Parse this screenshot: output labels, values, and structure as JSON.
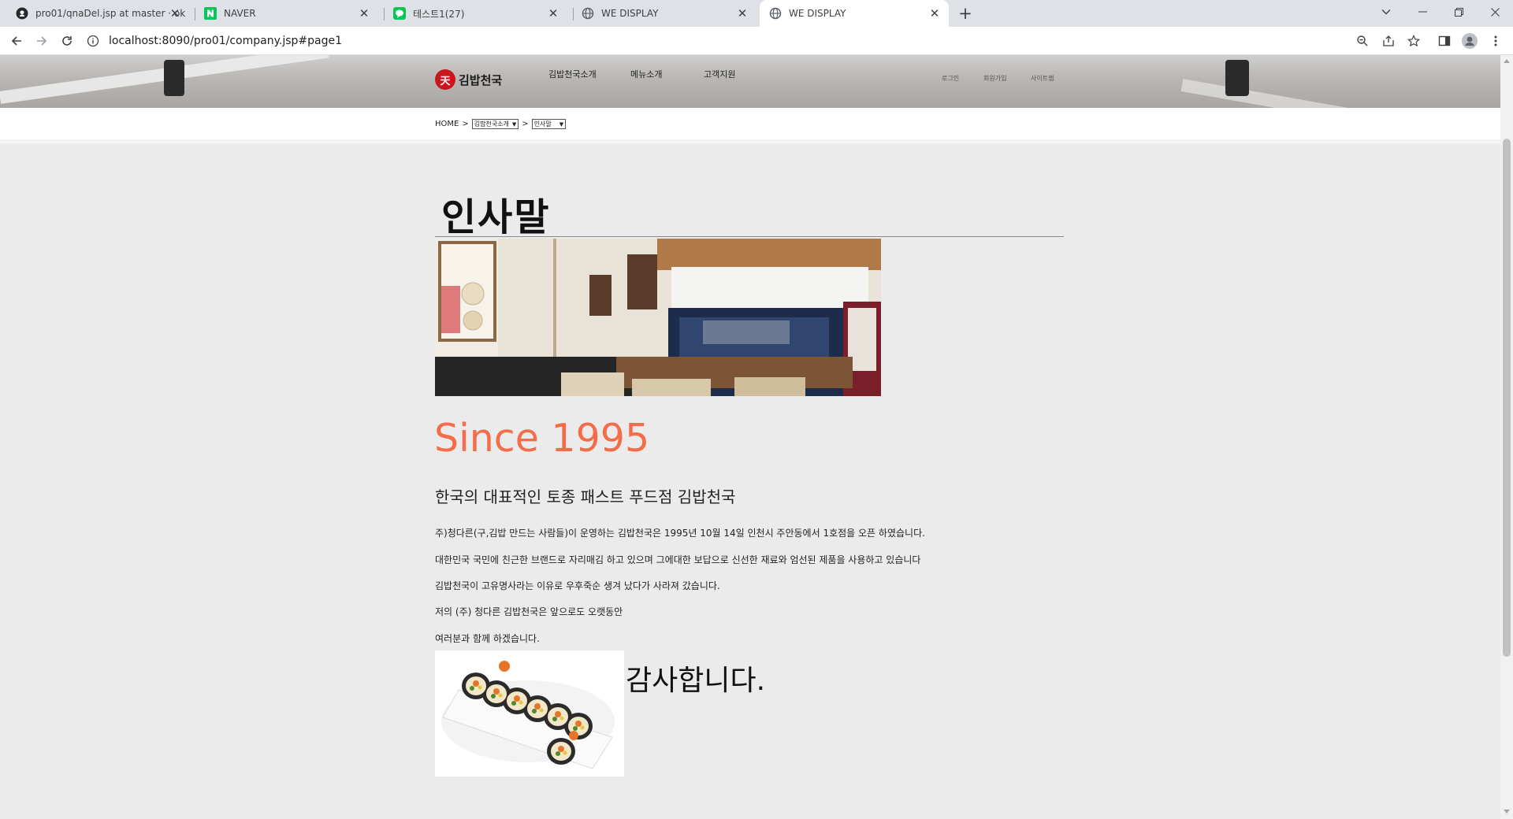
{
  "browser": {
    "tabs": [
      {
        "title": "pro01/qnaDel.jsp at master · ok",
        "icon": "github-icon",
        "active": false
      },
      {
        "title": "NAVER",
        "icon": "naver-icon",
        "active": false
      },
      {
        "title": "테스트1(27)",
        "icon": "chat-icon",
        "active": false
      },
      {
        "title": "WE DISPLAY",
        "icon": "globe-icon",
        "active": false
      },
      {
        "title": "WE DISPLAY",
        "icon": "globe-icon",
        "active": true
      }
    ],
    "url": "localhost:8090/pro01/company.jsp#page1",
    "tab_close_glyph": "✕",
    "new_tab_glyph": "+"
  },
  "site": {
    "logo_text": "김밥천국",
    "logo_mark": "天",
    "nav": [
      "김밥천국소개",
      "메뉴소개",
      "고객지원"
    ],
    "util": [
      "로그인",
      "회원가입",
      "사이트맵"
    ]
  },
  "breadcrumb": {
    "home": "HOME",
    "sep": ">",
    "select1": "김밥천국소개",
    "select2": "인사말"
  },
  "content": {
    "heading": "인사말",
    "since": "Since 1995",
    "subtitle": "한국의 대표적인 토종 패스트 푸드점 김밥천국",
    "paragraphs": [
      "주)청다른(구,김밥 만드는 사람들)이 운영하는 김밥천국은 1995년 10월 14일 인천시 주안동에서 1호점을 오픈 하였습니다.",
      "대한민국 국민에 친근한 브랜드로 자리매김 하고 있으며 그에대한 보답으로 신선한 재료와 엄선된 제품을 사용하고 있습니다",
      "김밥천국이 고유명사라는 이유로 우후죽순 생겨 났다가 사라져 갔습니다.",
      "저의 (주) 청다른 김밥천국은 앞으로도 오랫동안",
      "여러분과 함께 하겠습니다."
    ],
    "thanks": "감사합니다."
  },
  "colors": {
    "accent_since": "#f36d4a",
    "page_bg": "#ebebeb",
    "tab_bar": "#dee1e6"
  }
}
